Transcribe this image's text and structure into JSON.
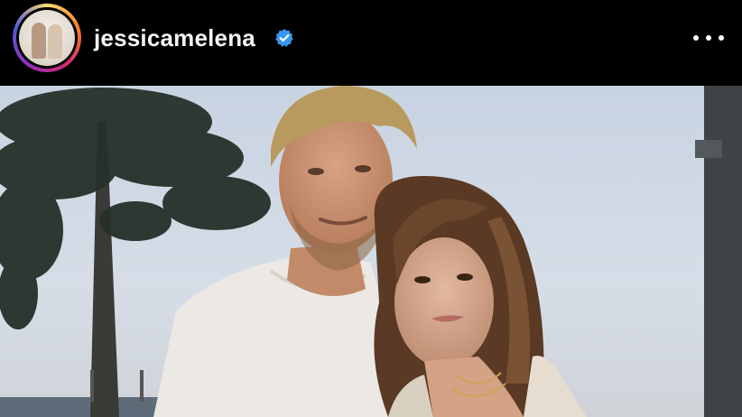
{
  "post_header": {
    "username": "jessicamelena",
    "verified_icon": "verified-badge-icon",
    "more_icon": "more-options-icon",
    "verified_color": "#3897f0"
  },
  "post": {
    "media_type": "photo",
    "description_icon": "post-photo"
  }
}
